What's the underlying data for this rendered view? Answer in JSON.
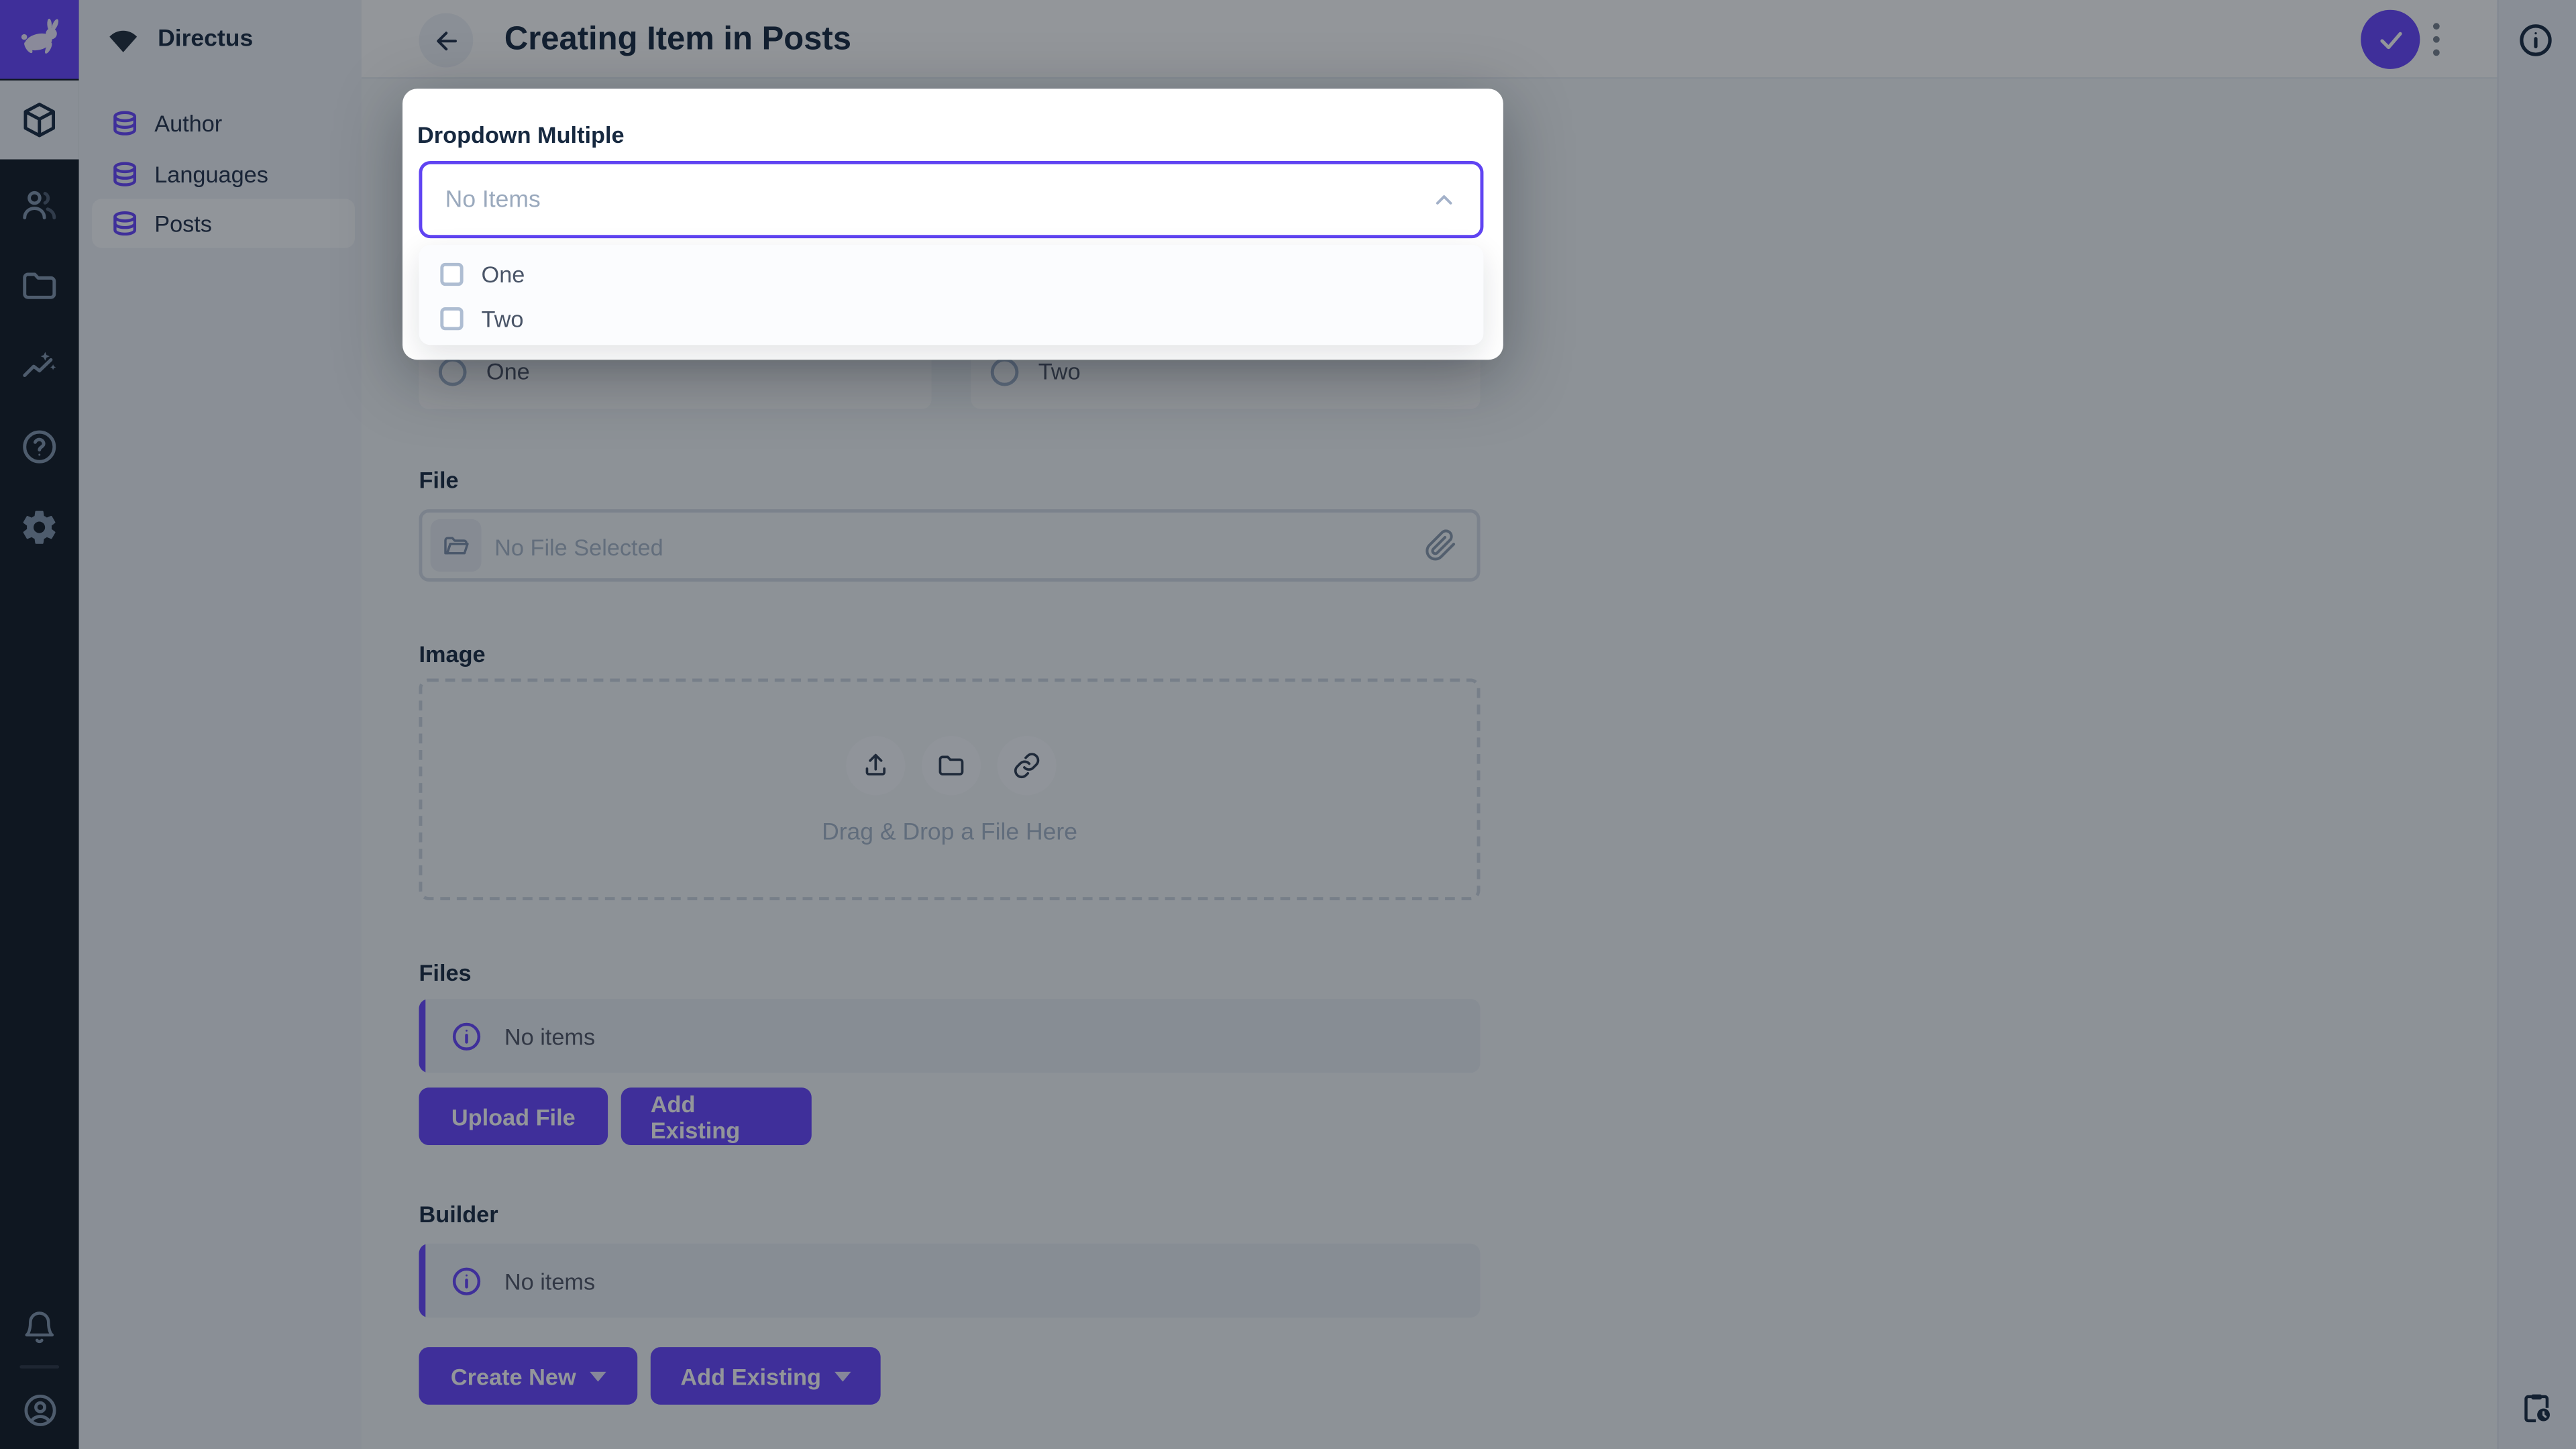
{
  "colors": {
    "accent": "#6644FF",
    "module_bar_bg": "#101824",
    "dark_text": "#172940",
    "body_text": "#4f5464",
    "muted": "#a2b5cd",
    "overlay": "rgba(15,22,32,0.45)"
  },
  "module_bar": {
    "logo_icon": "directus-rabbit-icon",
    "modules": [
      {
        "name": "content",
        "icon": "box-icon",
        "active": true
      },
      {
        "name": "users",
        "icon": "users-icon",
        "active": false
      },
      {
        "name": "files",
        "icon": "folder-icon",
        "active": false
      },
      {
        "name": "insights",
        "icon": "insights-icon",
        "active": false
      },
      {
        "name": "docs",
        "icon": "help-icon",
        "active": false
      },
      {
        "name": "settings",
        "icon": "gear-icon",
        "active": false
      }
    ],
    "bottom": [
      {
        "name": "notifications",
        "icon": "bell-icon"
      },
      {
        "name": "account",
        "icon": "user-circle-icon"
      }
    ]
  },
  "nav": {
    "project_name": "Directus",
    "project_icon": "fan-icon",
    "items": [
      {
        "label": "Author",
        "icon": "database-icon",
        "active": false
      },
      {
        "label": "Languages",
        "icon": "database-icon",
        "active": false
      },
      {
        "label": "Posts",
        "icon": "database-icon",
        "active": true
      }
    ]
  },
  "header": {
    "title": "Creating Item in Posts",
    "back_icon": "arrow-left-icon",
    "save_icon": "check-icon",
    "more_icon": "kebab-icon"
  },
  "right_sidebar": {
    "top_icon": "info-icon",
    "bottom_icon": "clipboard-clock-icon"
  },
  "popup": {
    "field_label": "Dropdown Multiple",
    "value": "No Items",
    "chevron_icon": "chevron-up-icon",
    "options": [
      {
        "label": "One",
        "checked": false
      },
      {
        "label": "Two",
        "checked": false
      }
    ]
  },
  "form": {
    "radios": [
      {
        "label": "One",
        "checked": false
      },
      {
        "label": "Two",
        "checked": false
      }
    ],
    "file": {
      "label": "File",
      "placeholder": "No File Selected",
      "left_icon": "folder-open-icon",
      "right_icon": "paperclip-icon"
    },
    "image": {
      "label": "Image",
      "hint": "Drag & Drop a File Here",
      "actions": [
        {
          "name": "upload",
          "icon": "upload-icon"
        },
        {
          "name": "choose-from-library",
          "icon": "folder-icon"
        },
        {
          "name": "import-from-url",
          "icon": "link-icon"
        }
      ]
    },
    "files": {
      "label": "Files",
      "notice": "No items",
      "notice_icon": "info-icon",
      "upload_button": "Upload File",
      "add_button": "Add Existing"
    },
    "builder": {
      "label": "Builder",
      "notice": "No items",
      "notice_icon": "info-icon",
      "create_button": "Create New",
      "add_button": "Add Existing"
    }
  }
}
